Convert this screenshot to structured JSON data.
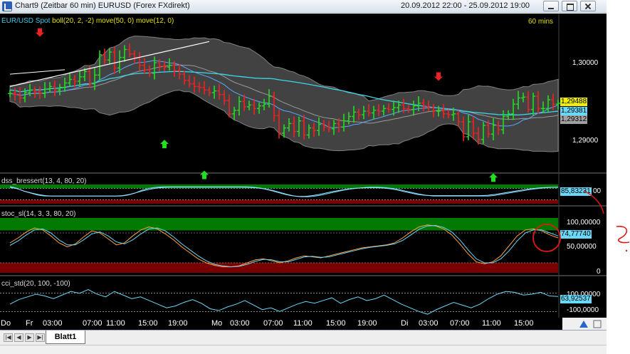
{
  "window": {
    "title": "Chart9 (Zeitbar 60 min)  EURUSD (Forex FXdirekt)",
    "date_range": "20.09.2012 22:00 - 25.09.2012 19:00"
  },
  "main_panel": {
    "symbol": "EUR/USD Spot",
    "indicators": "boll(20, 2, -2) move(50, 0) move(12, 0)",
    "timeframe": "60 mins",
    "y_labels": [
      "1,30000",
      "1,29000"
    ],
    "badges": [
      {
        "text": "1,29488",
        "bg": "#f0f000",
        "fg": "#000000"
      },
      {
        "text": "1,29381",
        "bg": "#6ad8f8",
        "fg": "#000000"
      },
      {
        "text": "1,29312",
        "bg": "#a0a0a0",
        "fg": "#000000"
      }
    ]
  },
  "dss_panel": {
    "title": "dss_bressert(13, 4, 80, 20)",
    "badge": {
      "text": "85,83231",
      "bg": "#6ad8f8",
      "fg": "#000000"
    },
    "badge_suffix": "00"
  },
  "stoc_panel": {
    "title": "stoc_sl(14, 3, 3, 80, 20)",
    "y_labels": [
      "100,00000",
      "50,00000",
      "0"
    ],
    "badge": {
      "text": "74,77740",
      "bg": "#6ad8f8",
      "fg": "#000000"
    }
  },
  "cci_panel": {
    "title": "cci_std(20, 100, -100)",
    "y_labels": [
      "100,00000",
      "-100,0000"
    ],
    "badge": {
      "text": "63,92537",
      "bg": "#6ad8f8",
      "fg": "#000000"
    }
  },
  "time_axis": [
    "Do",
    "Fr",
    "03:00",
    "07:00",
    "11:00",
    "15:00",
    "19:00",
    "Mo",
    "03:00",
    "07:00",
    "11:00",
    "15:00",
    "19:00",
    "Di",
    "03:00",
    "07:00",
    "11:00",
    "15:00"
  ],
  "tabs": {
    "sheet": "Blatt1"
  },
  "colors": {
    "background": "#000000",
    "bull": "#22dd22",
    "bear": "#ee2222",
    "band_fill": "#585858",
    "ma_fast": "#5aa8ff",
    "ma_slow": "#3ad8e8",
    "overbought_zone": "#007a00",
    "oversold_zone": "#7a0000"
  },
  "chart_data": [
    {
      "type": "candlestick",
      "title": "",
      "x_labels": [
        "Do",
        "Fr",
        "03:00",
        "07:00",
        "11:00",
        "15:00",
        "19:00",
        "Mo",
        "03:00",
        "07:00",
        "11:00",
        "15:00",
        "19:00",
        "Di",
        "03:00",
        "07:00",
        "11:00",
        "15:00"
      ],
      "y_ticks": [
        1.29,
        1.3
      ],
      "close": [
        1.2967,
        1.2966,
        1.2962,
        1.2968,
        1.2971,
        1.2969,
        1.2967,
        1.2972,
        1.2975,
        1.2971,
        1.2974,
        1.2979,
        1.2983,
        1.2981,
        1.2986,
        1.2992,
        1.2978,
        1.2988,
        1.3011,
        1.3005,
        1.3014,
        1.2996,
        1.3008,
        1.3017,
        1.3012,
        1.3008,
        1.2999,
        1.2994,
        1.299,
        1.3002,
        1.2998,
        1.2997,
        1.2999,
        1.2993,
        1.2989,
        1.2982,
        1.2978,
        1.2975,
        1.2974,
        1.2971,
        1.2968,
        1.297,
        1.2966,
        1.2959,
        1.2944,
        1.2948,
        1.2958,
        1.2952,
        1.2954,
        1.295,
        1.2953,
        1.2955,
        1.2964,
        1.2942,
        1.2922,
        1.2928,
        1.2933,
        1.2924,
        1.2936,
        1.292,
        1.2928,
        1.2925,
        1.2932,
        1.2929,
        1.2927,
        1.2933,
        1.2929,
        1.2936,
        1.2941,
        1.2946,
        1.2943,
        1.2947,
        1.2945,
        1.2948,
        1.2947,
        1.295,
        1.2949,
        1.2951,
        1.2954,
        1.295,
        1.2949,
        1.2953,
        1.2956,
        1.2952,
        1.2951,
        1.2947,
        1.2947,
        1.2944,
        1.2943,
        1.2944,
        1.2935,
        1.2918,
        1.2935,
        1.2922,
        1.2915,
        1.2931,
        1.2921,
        1.2931,
        1.2926,
        1.2941,
        1.2944,
        1.2955,
        1.2962,
        1.2963,
        1.2949,
        1.2964,
        1.295,
        1.295,
        1.296,
        1.2955,
        1.2956
      ]
    },
    {
      "type": "line",
      "title": "dss_bressert(13, 4, 80, 20)",
      "series": [
        {
          "name": "",
          "values": [
            90,
            80,
            65,
            55,
            45,
            40,
            40,
            40,
            40,
            40,
            40,
            40,
            40,
            40,
            40,
            40,
            40,
            45,
            55,
            70,
            80,
            85,
            88,
            88,
            88,
            88,
            88,
            88,
            88,
            88,
            88,
            88,
            88,
            88,
            88,
            86,
            82,
            76,
            68,
            58,
            48,
            40,
            36,
            36,
            40,
            46,
            54,
            62,
            70,
            76,
            80,
            84,
            86,
            86,
            84,
            80,
            74,
            66,
            58,
            50,
            44,
            40,
            40,
            40,
            40,
            40,
            40,
            40,
            40,
            40,
            44,
            50,
            56,
            62,
            68,
            74,
            78,
            82,
            85,
            86
          ]
        },
        {
          "name": "",
          "values": [
            85,
            78,
            66,
            56,
            48,
            42,
            40,
            40,
            40,
            40,
            40,
            40,
            40,
            40,
            40,
            40,
            42,
            48,
            58,
            68,
            76,
            82,
            85,
            86,
            86,
            86,
            86,
            86,
            86,
            86,
            86,
            86,
            86,
            86,
            85,
            83,
            78,
            70,
            60,
            50,
            42,
            38,
            38,
            42,
            48,
            56,
            64,
            70,
            76,
            80,
            82,
            84,
            84,
            82,
            78,
            72,
            64,
            56,
            48,
            44,
            42,
            42,
            42,
            42,
            42,
            42,
            42,
            42,
            44,
            48,
            54,
            60,
            66,
            72,
            77,
            81,
            84,
            85,
            85
          ]
        }
      ],
      "hlines": [
        80,
        20
      ]
    },
    {
      "type": "line",
      "title": "stoc_sl(14, 3, 3, 80, 20)",
      "y_ticks": [
        0,
        50,
        100
      ],
      "series": [
        {
          "name": "",
          "values": [
            60,
            70,
            82,
            90,
            86,
            74,
            60,
            52,
            58,
            72,
            84,
            80,
            68,
            56,
            60,
            74,
            86,
            92,
            88,
            78,
            66,
            52,
            40,
            28,
            20,
            15,
            12,
            12,
            14,
            20,
            26,
            28,
            24,
            20,
            24,
            30,
            34,
            32,
            30,
            34,
            38,
            42,
            46,
            50,
            52,
            54,
            56,
            60,
            70,
            82,
            92,
            96,
            94,
            88,
            76,
            58,
            38,
            22,
            18,
            22,
            34,
            54,
            74,
            86,
            88,
            84,
            76,
            70
          ]
        },
        {
          "name": "",
          "values": [
            55,
            64,
            76,
            86,
            88,
            80,
            66,
            56,
            56,
            66,
            78,
            82,
            74,
            62,
            58,
            66,
            78,
            88,
            90,
            84,
            72,
            58,
            46,
            34,
            24,
            17,
            14,
            12,
            13,
            17,
            23,
            27,
            26,
            22,
            22,
            27,
            32,
            33,
            31,
            32,
            36,
            40,
            44,
            48,
            51,
            53,
            55,
            58,
            65,
            76,
            87,
            94,
            95,
            91,
            82,
            66,
            46,
            28,
            20,
            20,
            28,
            44,
            64,
            80,
            86,
            86,
            80,
            74
          ]
        }
      ],
      "hlines": [
        80,
        20
      ]
    },
    {
      "type": "line",
      "title": "cci_std(20, 100, -100)",
      "y_ticks": [
        -100,
        100
      ],
      "series": [
        {
          "name": "",
          "values": [
            -20,
            30,
            60,
            90,
            70,
            40,
            80,
            120,
            100,
            140,
            90,
            60,
            120,
            80,
            40,
            60,
            20,
            -20,
            -60,
            -40,
            0,
            30,
            -10,
            -70,
            -90,
            -50,
            -20,
            20,
            -30,
            -80,
            -60,
            -100,
            -60,
            -20,
            10,
            -10,
            20,
            50,
            -10,
            30,
            60,
            20,
            40,
            80,
            30,
            -20,
            -60,
            -100,
            -130,
            -80,
            -40,
            0,
            -30,
            -60,
            -20,
            40,
            90,
            120,
            110,
            80,
            90,
            110,
            70,
            64
          ]
        }
      ],
      "hlines": [
        100,
        -100
      ]
    }
  ]
}
